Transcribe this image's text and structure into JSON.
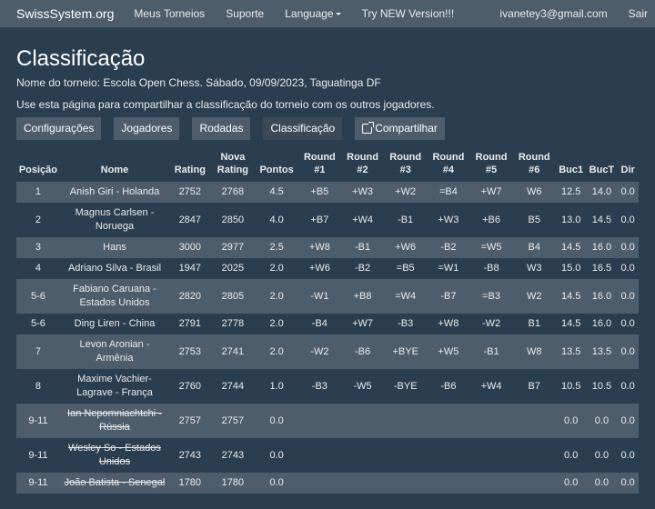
{
  "nav": {
    "brand": "SwissSystem.org",
    "links": [
      "Meus Torneios",
      "Suporte",
      "Language",
      "Try NEW Version!!!"
    ],
    "email": "ivanetey3@gmail.com",
    "logout": "Sair"
  },
  "page": {
    "title": "Classificação",
    "tournament_line": "Nome do torneio: Escola Open Chess. Sábado, 09/09/2023, Taguatinga DF",
    "share_line": "Use esta página para compartilhar a classificação do torneio com os outros jogadores."
  },
  "buttons": {
    "config": "Configurações",
    "players": "Jogadores",
    "rounds": "Rodadas",
    "standings": "Classificação",
    "share": "Compartilhar"
  },
  "table": {
    "headers": [
      "Posição",
      "Nome",
      "Rating",
      "Nova Rating",
      "Pontos",
      "Round #1",
      "Round #2",
      "Round #3",
      "Round #4",
      "Round #5",
      "Round #6",
      "Buc1",
      "BucT",
      "Dir"
    ],
    "rows": [
      {
        "pos": "1",
        "name": "Anish Giri - Holanda",
        "rating": "2752",
        "new_rating": "2768",
        "points": "4.5",
        "r1": "+B5",
        "r2": "+W3",
        "r3": "+W2",
        "r4": "=B4",
        "r5": "+W7",
        "r6": "W6",
        "buc1": "12.5",
        "buct": "14.0",
        "dir": "0.0",
        "withdrawn": false
      },
      {
        "pos": "2",
        "name": "Magnus Carlsen - Noruega",
        "rating": "2847",
        "new_rating": "2850",
        "points": "4.0",
        "r1": "+B7",
        "r2": "+W4",
        "r3": "-B1",
        "r4": "+W3",
        "r5": "+B6",
        "r6": "B5",
        "buc1": "13.0",
        "buct": "14.5",
        "dir": "0.0",
        "withdrawn": false
      },
      {
        "pos": "3",
        "name": "Hans",
        "rating": "3000",
        "new_rating": "2977",
        "points": "2.5",
        "r1": "+W8",
        "r2": "-B1",
        "r3": "+W6",
        "r4": "-B2",
        "r5": "=W5",
        "r6": "B4",
        "buc1": "14.5",
        "buct": "16.0",
        "dir": "0.0",
        "withdrawn": false
      },
      {
        "pos": "4",
        "name": "Adriano Silva - Brasil",
        "rating": "1947",
        "new_rating": "2025",
        "points": "2.0",
        "r1": "+W6",
        "r2": "-B2",
        "r3": "=B5",
        "r4": "=W1",
        "r5": "-B8",
        "r6": "W3",
        "buc1": "15.0",
        "buct": "16.5",
        "dir": "0.0",
        "withdrawn": false
      },
      {
        "pos": "5-6",
        "name": "Fabiano Caruana - Estados Unidos",
        "rating": "2820",
        "new_rating": "2805",
        "points": "2.0",
        "r1": "-W1",
        "r2": "+B8",
        "r3": "=W4",
        "r4": "-B7",
        "r5": "=B3",
        "r6": "W2",
        "buc1": "14.5",
        "buct": "16.0",
        "dir": "0.0",
        "withdrawn": false
      },
      {
        "pos": "5-6",
        "name": "Ding Liren - China",
        "rating": "2791",
        "new_rating": "2778",
        "points": "2.0",
        "r1": "-B4",
        "r2": "+W7",
        "r3": "-B3",
        "r4": "+W8",
        "r5": "-W2",
        "r6": "B1",
        "buc1": "14.5",
        "buct": "16.0",
        "dir": "0.0",
        "withdrawn": false
      },
      {
        "pos": "7",
        "name": "Levon Aronian - Armênia",
        "rating": "2753",
        "new_rating": "2741",
        "points": "2.0",
        "r1": "-W2",
        "r2": "-B6",
        "r3": "+BYE",
        "r4": "+W5",
        "r5": "-B1",
        "r6": "W8",
        "buc1": "13.5",
        "buct": "13.5",
        "dir": "0.0",
        "withdrawn": false
      },
      {
        "pos": "8",
        "name": "Maxime Vachier-Lagrave - França",
        "rating": "2760",
        "new_rating": "2744",
        "points": "1.0",
        "r1": "-B3",
        "r2": "-W5",
        "r3": "-BYE",
        "r4": "-B6",
        "r5": "+W4",
        "r6": "B7",
        "buc1": "10.5",
        "buct": "10.5",
        "dir": "0.0",
        "withdrawn": false
      },
      {
        "pos": "9-11",
        "name": "Ian Nepomniachtchi - Rússia",
        "rating": "2757",
        "new_rating": "2757",
        "points": "0.0",
        "r1": "",
        "r2": "",
        "r3": "",
        "r4": "",
        "r5": "",
        "r6": "",
        "buc1": "0.0",
        "buct": "0.0",
        "dir": "0.0",
        "withdrawn": true
      },
      {
        "pos": "9-11",
        "name": "Wesley So - Estados Unidos",
        "rating": "2743",
        "new_rating": "2743",
        "points": "0.0",
        "r1": "",
        "r2": "",
        "r3": "",
        "r4": "",
        "r5": "",
        "r6": "",
        "buc1": "0.0",
        "buct": "0.0",
        "dir": "0.0",
        "withdrawn": true
      },
      {
        "pos": "9-11",
        "name": "João Batista - Senegal",
        "rating": "1780",
        "new_rating": "1780",
        "points": "0.0",
        "r1": "",
        "r2": "",
        "r3": "",
        "r4": "",
        "r5": "",
        "r6": "",
        "buc1": "0.0",
        "buct": "0.0",
        "dir": "0.0",
        "withdrawn": true
      }
    ]
  }
}
